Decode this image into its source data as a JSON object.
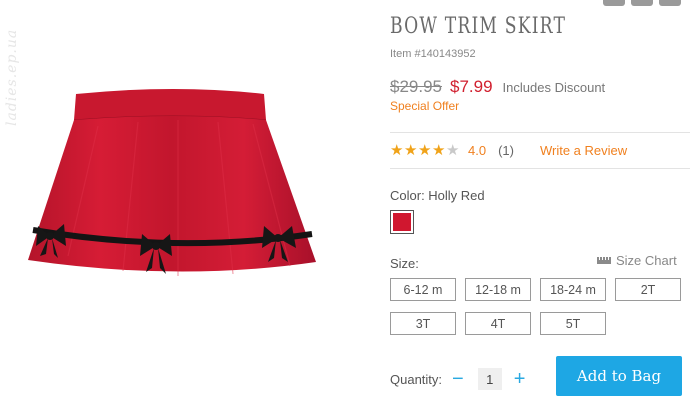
{
  "watermark": "ladies.ep.ua",
  "product": {
    "title": "Bow Trim Skirt",
    "item_number": "Item #140143952",
    "original_price": "$29.95",
    "sale_price": "$7.99",
    "discount_note": "Includes Discount",
    "special_offer": "Special Offer"
  },
  "rating": {
    "value": "4.0",
    "stars_filled": 4,
    "stars_total": 5,
    "review_count": "(1)",
    "write_review": "Write a Review"
  },
  "color": {
    "label": "Color: Holly Red",
    "swatch_color": "#d0172f"
  },
  "size": {
    "label": "Size:",
    "size_chart": "Size Chart",
    "options": [
      "6-12 m",
      "12-18 m",
      "18-24 m",
      "2T",
      "3T",
      "4T",
      "5T"
    ]
  },
  "quantity": {
    "label": "Quantity:",
    "minus": "−",
    "value": "1",
    "plus": "+"
  },
  "cart": {
    "add_to_bag": "Add to Bag"
  },
  "colors": {
    "accent_orange": "#f0801f",
    "sale_red": "#d1202f",
    "button_blue": "#1ea7e4"
  }
}
